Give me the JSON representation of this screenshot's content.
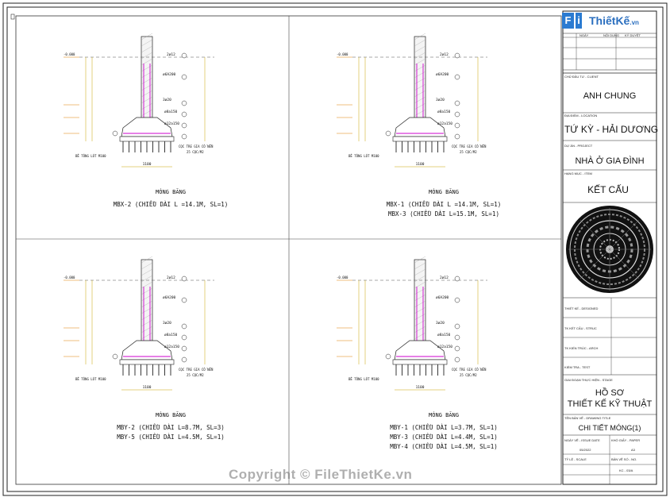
{
  "logo": {
    "letters": [
      "F",
      "i",
      "l",
      "e"
    ],
    "brand": "ThiếtKế",
    "tld": ".vn"
  },
  "panels": [
    {
      "title": "MÓNG BĂNG",
      "lines": [
        "MBX-2 (CHIỀU DÀI L =14.1M, SL=1)"
      ]
    },
    {
      "title": "MÓNG BĂNG",
      "lines": [
        "MBX-1 (CHIỀU DÀI L =14.1M, SL=1)",
        "MBX-3 (CHIỀU DÀI L=15.1M, SL=1)"
      ]
    },
    {
      "title": "MÓNG BĂNG",
      "lines": [
        "MBY-2 (CHIỀU DÀI L=8.7M, SL=3)",
        "MBY-5 (CHIỀU DÀI L=4.5M, SL=1)"
      ]
    },
    {
      "title": "MÓNG BĂNG",
      "lines": [
        "MBY-1 (CHIỀU DÀI L=3.7M, SL=1)",
        "MBY-3 (CHIỀU DÀI L=4.4M, SL=1)",
        "MBY-4 (CHIỀU DÀI L=4.5M, SL=1)"
      ]
    }
  ],
  "detail_labels": {
    "bars_top": "2ø12",
    "stirrup": "ø6A200",
    "bars_mid": "3ø20",
    "stirrup2": "ø8a150",
    "bars_bottom": "ø12a150",
    "pile_note_1": "CỌC TRE GIA CỐ NỀN",
    "pile_note_2": "25 CỌC/M2",
    "lean_concrete": "BÊ TÔNG LÓT M100",
    "width": "1100",
    "level_top": "-0.000"
  },
  "title_block": {
    "owner_label": "CHỦ ĐẦU TƯ - CLIENT",
    "owner": "ANH CHUNG",
    "location_label": "ĐỊA ĐIỂM - LOCATION",
    "location": "TỨ KỲ - HẢI DƯƠNG",
    "project_label": "DỰ ÁN - PROJECT",
    "project": "NHÀ Ở GIA ĐÌNH",
    "item_label": "HẠNG MỤC - ITEM",
    "item": "KẾT CẤU",
    "designer_label": "THIẾT KẾ - DESIGNED",
    "structure_label": "TK KẾT CẤU - STRUC",
    "architecture_label": "TK KIẾN TRÚC - ARCH",
    "check_label": "KIỂM TRA - TEST",
    "stage_label": "GIAI ĐOẠN THỰC HIỆN - STAGE",
    "stage_1": "HỒ SƠ",
    "stage_2": "THIẾT KẾ KỸ THUẬT",
    "drawing_label": "TÊN BẢN VẼ - DRAWING TITLE",
    "drawing_title": "CHI TIẾT MÓNG(1)",
    "date_label": "NGÀY VẼ - ISSUE DATE",
    "size_label": "KHỔ GIẤY - PAPER",
    "date": "05/2022",
    "size": "A3",
    "scale_label": "TỶ LỆ - SCALE",
    "sheet_label": "BẢN VẼ SỐ - NO.",
    "sheet_no": "KC - 03/A",
    "rev_col1": "NGÀY",
    "rev_col2": "NỘI DUNG",
    "rev_col3": "KÝ DUYỆT"
  },
  "watermark": "Copyright © FileThietKe.vn",
  "colors": {
    "accent_magenta": "#cc00cc",
    "accent_yellow": "#c8a400",
    "accent_orange": "#e08000",
    "logo_blue": "#2b7bd1",
    "title_red": "#cc0000"
  }
}
